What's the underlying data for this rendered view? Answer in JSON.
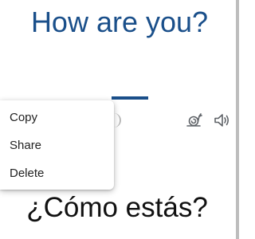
{
  "translation": {
    "source_text": "How are you?",
    "target_text": "¿Cómo estás?"
  },
  "context_menu": {
    "items": [
      {
        "label": "Copy"
      },
      {
        "label": "Share"
      },
      {
        "label": "Delete"
      }
    ]
  },
  "controls": {
    "slow_playback_icon": "snail-icon",
    "speaker_icon": "speaker-icon"
  },
  "colors": {
    "accent": "#1a4f8a",
    "icon": "#5f6368",
    "text": "#111111"
  }
}
